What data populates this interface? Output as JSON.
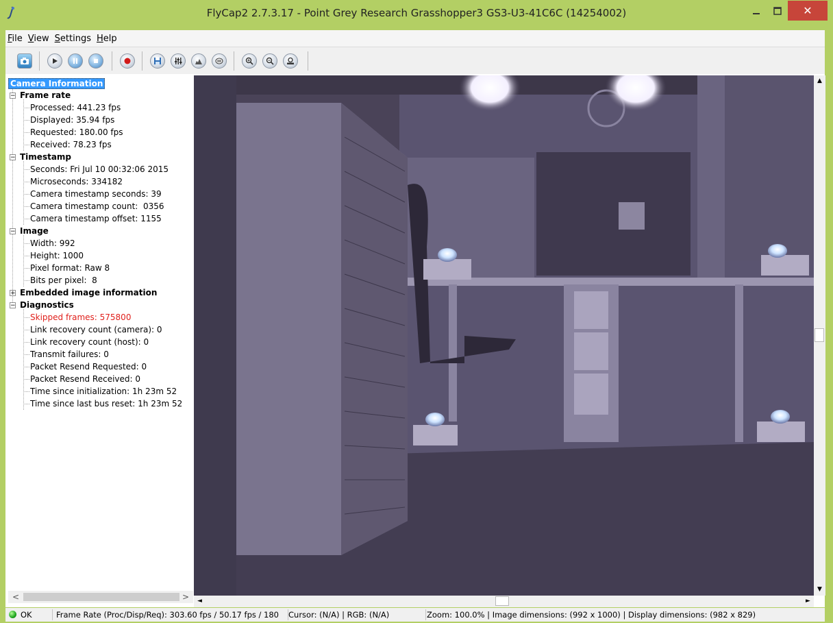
{
  "window": {
    "title": "FlyCap2 2.7.3.17 - Point Grey Research Grasshopper3 GS3-U3-41C6C (14254002)",
    "minimize": "–",
    "maximize": "☐",
    "close": "✕"
  },
  "menu": [
    "File",
    "View",
    "Settings",
    "Help"
  ],
  "toolbar": [
    "camera-icon",
    "play-icon",
    "pause-icon",
    "stop-icon",
    "record-icon",
    "save-icon",
    "settings-icon",
    "histogram-icon",
    "event-stats-icon",
    "zoom-in-icon",
    "zoom-out-icon",
    "zoom-100-icon"
  ],
  "tree": {
    "root": "Camera Information",
    "frame_rate": {
      "label": "Frame rate",
      "items": [
        "Processed: 441.23 fps",
        "Displayed: 35.94 fps",
        "Requested: 180.00 fps",
        "Received: 78.23 fps"
      ]
    },
    "timestamp": {
      "label": "Timestamp",
      "items": [
        "Seconds: Fri Jul 10 00:32:06 2015",
        "Microseconds: 334182",
        "Camera timestamp seconds: 39",
        "Camera timestamp count:  0356",
        "Camera timestamp offset: 1155"
      ]
    },
    "image": {
      "label": "Image",
      "items": [
        "Width: 992",
        "Height: 1000",
        "Pixel format: Raw 8",
        "Bits per pixel:  8"
      ]
    },
    "embedded": {
      "label": "Embedded image information"
    },
    "diagnostics": {
      "label": "Diagnostics",
      "items": [
        "Skipped frames: 575800",
        "Link recovery count (camera): 0",
        "Link recovery count (host): 0",
        "Transmit failures: 0",
        "Packet Resend Requested: 0",
        "Packet Resend Received: 0",
        "Time since initialization: 1h 23m 52",
        "Time since last bus reset: 1h 23m 52"
      ]
    },
    "expand_plus": "+",
    "expand_minus": "−"
  },
  "statusbar": {
    "status": "OK",
    "frame_rate": "Frame Rate (Proc/Disp/Req): 303.60 fps / 50.17 fps / 180",
    "cursor": "Cursor: (N/A) | RGB: (N/A)",
    "zoom": "Zoom: 100.0% | Image dimensions: (992 x 1000) | Display dimensions: (982 x 829)"
  },
  "scroll": {
    "left": "<",
    "right": ">",
    "up": "▲",
    "down": "▼",
    "left_small": "◄",
    "right_small": "►"
  },
  "colors": {
    "title_bg": "#b3cf64",
    "close_btn": "#c7453a",
    "selection": "#3399ff",
    "warning_text": "#e0201c"
  }
}
